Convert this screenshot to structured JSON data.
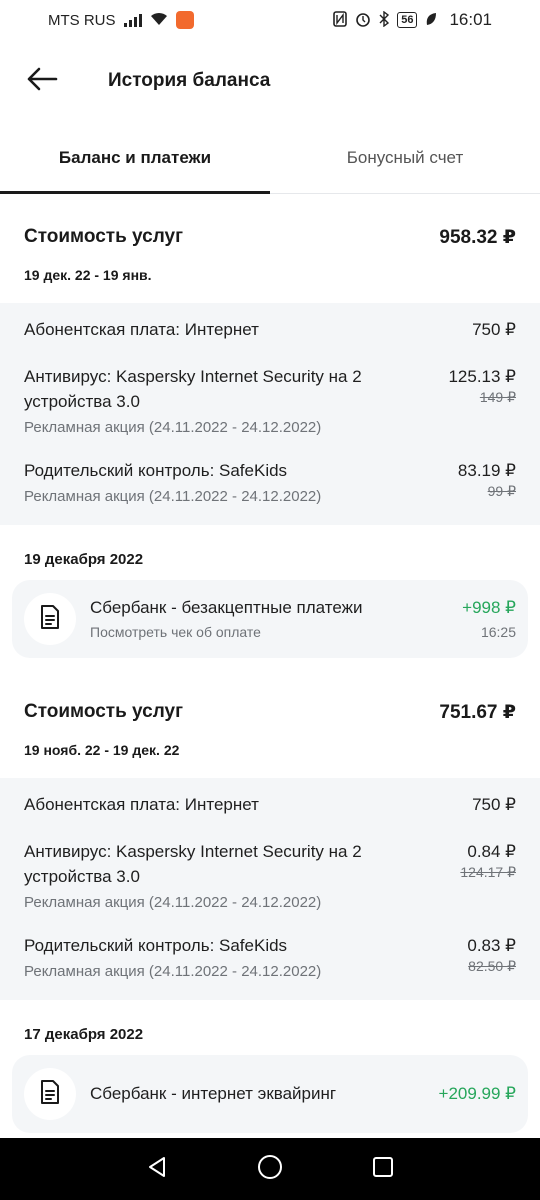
{
  "status_bar": {
    "carrier": "MTS RUS",
    "battery": "56",
    "time": "16:01"
  },
  "header": {
    "title": "История баланса",
    "back_icon": "arrow-left-icon"
  },
  "tabs": [
    {
      "label": "Баланс и платежи",
      "active": true
    },
    {
      "label": "Бонусный счет",
      "active": false
    }
  ],
  "periods": [
    {
      "title": "Стоимость услуг",
      "total": "958.32 ₽",
      "dates": "19 дек. 22 - 19 янв.",
      "charges": [
        {
          "name": "Абонентская плата: Интернет",
          "amount": "750 ₽",
          "note": "",
          "old": ""
        },
        {
          "name": "Антивирус: Kaspersky Internet Security на 2 устройства 3.0",
          "amount": "125.13 ₽",
          "note": "Рекламная акция (24.11.2022 - 24.12.2022)",
          "old": "149 ₽"
        },
        {
          "name": "Родительский контроль: SafeKids",
          "amount": "83.19 ₽",
          "note": "Рекламная акция (24.11.2022 - 24.12.2022)",
          "old": "99 ₽"
        }
      ],
      "payment_date": "19 декабря 2022",
      "payment": {
        "name": "Сбербанк - безакцептные платежи",
        "link": "Посмотреть чек об оплате",
        "amount": "+998 ₽",
        "time": "16:25"
      }
    },
    {
      "title": "Стоимость услуг",
      "total": "751.67 ₽",
      "dates": "19 нояб. 22 - 19 дек. 22",
      "charges": [
        {
          "name": "Абонентская плата: Интернет",
          "amount": "750 ₽",
          "note": "",
          "old": ""
        },
        {
          "name": "Антивирус: Kaspersky Internet Security на 2 устройства 3.0",
          "amount": "0.84 ₽",
          "note": "Рекламная акция (24.11.2022 - 24.12.2022)",
          "old": "124.17 ₽"
        },
        {
          "name": "Родительский контроль: SafeKids",
          "amount": "0.83 ₽",
          "note": "Рекламная акция (24.11.2022 - 24.12.2022)",
          "old": "82.50 ₽"
        }
      ],
      "payment_date": "17 декабря 2022",
      "payment": {
        "name": "Сбербанк - интернет эквайринг",
        "link": "",
        "amount": "+209.99 ₽",
        "time": ""
      }
    }
  ],
  "colors": {
    "positive": "#26a65b",
    "card_bg": "#f4f6f8",
    "muted": "#6f7378"
  }
}
